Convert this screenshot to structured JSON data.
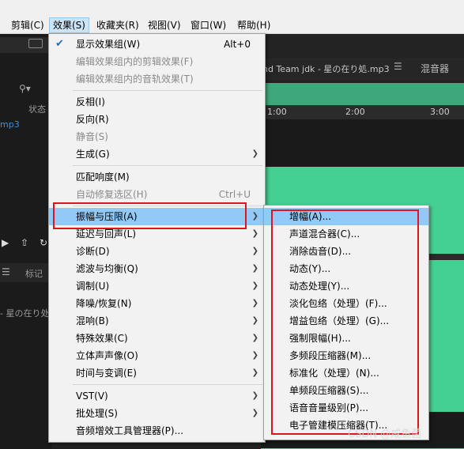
{
  "menubar": [
    "剪辑(C)",
    "效果(S)",
    "收藏夹(R)",
    "视图(V)",
    "窗口(W)",
    "帮助(H)"
  ],
  "background": {
    "file_tab": "nd Team jdk - 星の在り処.mp3",
    "mixer_tab": "混音器",
    "times": [
      "1:00",
      "2:00",
      "3:00"
    ],
    "left_status": "状态",
    "left_file": "mp3",
    "markers_tab": "标记",
    "left_track": "- 星の在り处"
  },
  "effects_menu": [
    {
      "label": "显示效果组(W)",
      "shortcut": "Alt+0",
      "checked": true
    },
    {
      "label": "编辑效果组内的剪辑效果(F)",
      "disabled": true
    },
    {
      "label": "编辑效果组内的音轨效果(T)",
      "disabled": true
    },
    {
      "separator": true
    },
    {
      "label": "反相(I)"
    },
    {
      "label": "反向(R)"
    },
    {
      "label": "静音(S)",
      "disabled": true
    },
    {
      "label": "生成(G)",
      "submenu": true
    },
    {
      "separator": true
    },
    {
      "label": "匹配响度(M)"
    },
    {
      "label": "自动修复选区(H)",
      "shortcut": "Ctrl+U",
      "disabled": true
    },
    {
      "separator": true
    },
    {
      "label": "振幅与压限(A)",
      "submenu": true,
      "highlighted": true
    },
    {
      "label": "延迟与回声(L)",
      "submenu": true
    },
    {
      "label": "诊断(D)",
      "submenu": true
    },
    {
      "label": "滤波与均衡(Q)",
      "submenu": true
    },
    {
      "label": "调制(U)",
      "submenu": true
    },
    {
      "label": "降噪/恢复(N)",
      "submenu": true
    },
    {
      "label": "混响(B)",
      "submenu": true
    },
    {
      "label": "特殊效果(C)",
      "submenu": true
    },
    {
      "label": "立体声声像(O)",
      "submenu": true
    },
    {
      "label": "时间与变调(E)",
      "submenu": true
    },
    {
      "separator": true
    },
    {
      "label": "VST(V)",
      "submenu": true
    },
    {
      "label": "批处理(S)",
      "submenu": true
    },
    {
      "label": "音频增效工具管理器(P)..."
    }
  ],
  "amplitude_submenu": [
    "增幅(A)...",
    "声道混合器(C)...",
    "消除齿音(D)...",
    "动态(Y)...",
    "动态处理(Y)...",
    "淡化包络（处理）(F)...",
    "增益包络（处理）(G)...",
    "强制限幅(H)...",
    "多频段压缩器(M)...",
    "标准化（处理）(N)...",
    "单频段压缩器(S)...",
    "语音音量级别(P)...",
    "电子管建模压缩器(T)..."
  ],
  "watermark": "CSDN @咸鱼菌",
  "colors": {
    "highlight": "#91c9f7",
    "waveform": "#45d093",
    "annotation": "#e0141e"
  }
}
